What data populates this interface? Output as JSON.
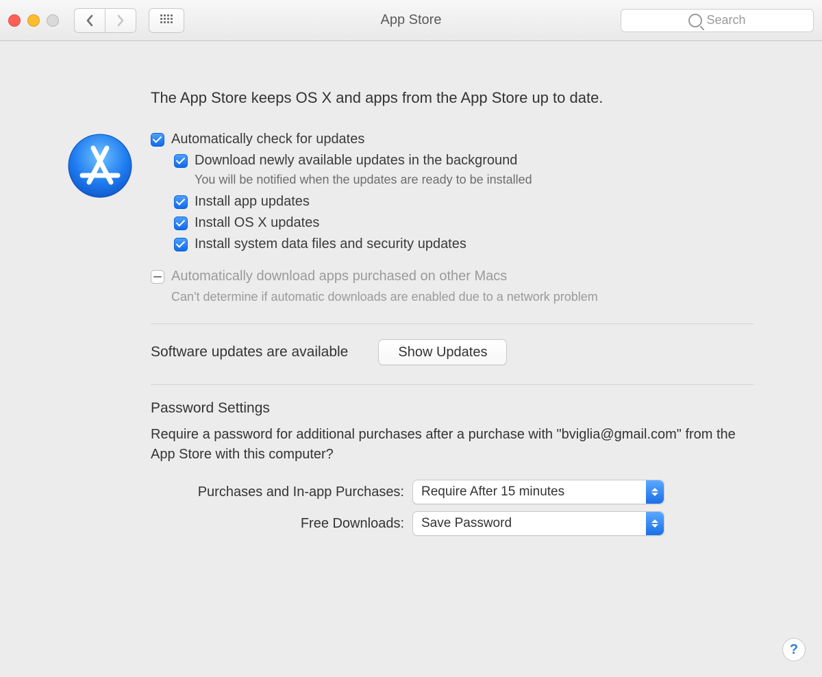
{
  "window": {
    "title": "App Store"
  },
  "toolbar": {
    "search_placeholder": "Search"
  },
  "heading": "The App Store keeps OS X and apps from the App Store up to date.",
  "options": {
    "auto_check": {
      "label": "Automatically check for updates",
      "checked": true
    },
    "download_bg": {
      "label": "Download newly available updates in the background",
      "note": "You will be notified when the updates are ready to be installed",
      "checked": true
    },
    "install_app": {
      "label": "Install app updates",
      "checked": true
    },
    "install_osx": {
      "label": "Install OS X updates",
      "checked": true
    },
    "install_sys": {
      "label": "Install system data files and security updates",
      "checked": true
    },
    "auto_download_other": {
      "label": "Automatically download apps purchased on other Macs",
      "note": "Can't determine if automatic downloads are enabled due to a network problem",
      "state": "mixed"
    }
  },
  "updates": {
    "status": "Software updates are available",
    "button": "Show Updates"
  },
  "password_settings": {
    "title": "Password Settings",
    "description": "Require a password for additional purchases after a purchase with \"bviglia@gmail.com\" from the App Store with this computer?",
    "purchases_label": "Purchases and In-app Purchases:",
    "purchases_value": "Require After 15 minutes",
    "free_label": "Free Downloads:",
    "free_value": "Save Password"
  },
  "help_label": "?"
}
